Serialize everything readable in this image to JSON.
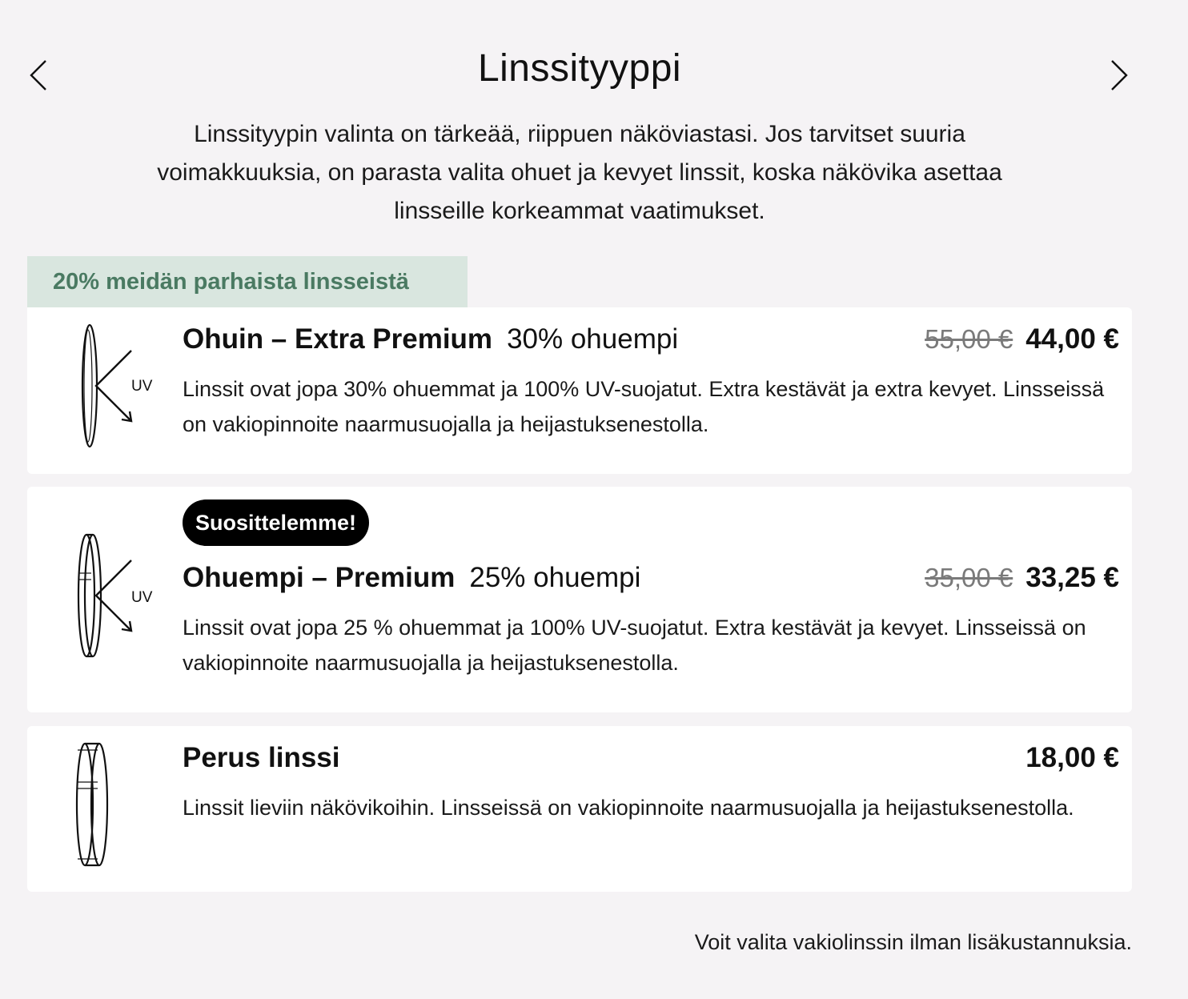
{
  "header": {
    "title": "Linssityyppi",
    "prev_icon": "chevron-left-icon",
    "next_icon": "chevron-right-icon"
  },
  "intro": "Linssityypin valinta on tärkeää, riippuen näköviastasi. Jos tarvitset suuria voimakkuuksia, on parasta valita ohuet ja kevyet linssit, koska näkövika asettaa linsseille korkeammat vaatimukset.",
  "promo": {
    "label": "20% meidän parhaista linsseistä"
  },
  "options": [
    {
      "name": "Ohuin – Extra Premium",
      "thinness": "30% ohuempi",
      "old_price": "55,00 €",
      "price": "44,00 €",
      "description": "Linssit ovat jopa 30% ohuemmat ja 100% UV-suojatut. Extra kestävät ja extra kevyet. Linsseissä on vakiopinnoite naarmusuojalla ja heijastuksenestolla.",
      "uv_label": "UV",
      "icon": "thin-lens-uv-icon"
    },
    {
      "badge": "Suosittelemme!",
      "name": "Ohuempi – Premium",
      "thinness": "25% ohuempi",
      "old_price": "35,00 €",
      "price": "33,25 €",
      "description": "Linssit ovat jopa 25 % ohuemmat ja 100% UV-suojatut. Extra kestävät ja kevyet. Linsseissä on vakiopinnoite naarmusuojalla ja heijastuksenestolla.",
      "uv_label": "UV",
      "icon": "medium-lens-uv-icon"
    },
    {
      "name": "Perus linssi",
      "price": "18,00 €",
      "description": "Linssit lieviin näkövikoihin. Linsseissä on vakiopinnoite naarmusuojalla ja heijastuksenestolla.",
      "icon": "basic-lens-icon"
    }
  ],
  "footnote": "Voit valita vakiolinssin ilman lisäkustannuksia.",
  "colors": {
    "background": "#f5f3f5",
    "card": "#ffffff",
    "promo_bg": "#d9e6df",
    "promo_text": "#4a7a62",
    "badge_bg": "#000000"
  }
}
